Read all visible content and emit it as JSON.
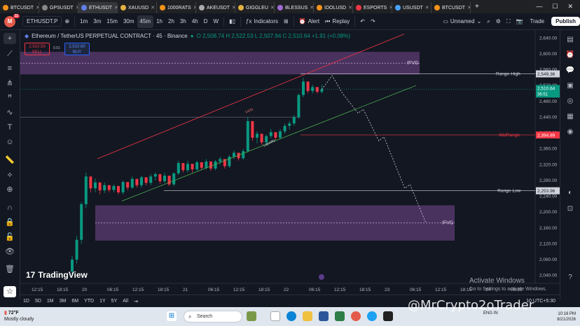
{
  "browser": {
    "tabs": [
      {
        "label": "BTCUSDT",
        "color": "#f7931a",
        "active": false
      },
      {
        "label": "GPSUSDT",
        "color": "#888888",
        "active": false
      },
      {
        "label": "ETHUSDT",
        "color": "#627eea",
        "active": true
      },
      {
        "label": "XAUUSD",
        "color": "#e3b341",
        "active": false
      },
      {
        "label": "1000RATS",
        "color": "#f7931a",
        "active": false
      },
      {
        "label": "AKEUSDT",
        "color": "#aaaaaa",
        "active": false
      },
      {
        "label": "GIGGLEU",
        "color": "#e3b341",
        "active": false
      },
      {
        "label": "BLESSUS",
        "color": "#a06cd5",
        "active": false
      },
      {
        "label": "IDOLUSD",
        "color": "#f7931a",
        "active": false
      },
      {
        "label": "ESPORTS",
        "color": "#f23645",
        "active": false
      },
      {
        "label": "USUSDT",
        "color": "#4aa3ff",
        "active": false
      },
      {
        "label": "BTCUSDT",
        "color": "#f7931a",
        "active": false
      }
    ]
  },
  "toolbar": {
    "avatar_letter": "M",
    "avatar_badge": "11",
    "symbol": "ETHUSDT.P",
    "intervals": [
      "1m",
      "3m",
      "15m",
      "30m",
      "45m",
      "1h",
      "2h",
      "3h",
      "4h",
      "D",
      "W"
    ],
    "active_interval": "45m",
    "indicators_label": "Indicators",
    "alert_label": "Alert",
    "replay_label": "Replay",
    "layout_name": "Unnamed",
    "trade_label": "Trade",
    "publish_label": "Publish"
  },
  "header": {
    "title": "Ethereum / TetherUS PERPETUAL CONTRACT · 45 · Binance",
    "ohlc": "O 2,508.74  H 2,522.53  L 2,507.94  C 2,510.64  +1.91 (+0.08%)",
    "sell_price": "2,510.59",
    "sell_label": "SELL",
    "buy_price": "2,510.60",
    "buy_label": "BUY",
    "spread": "0.01"
  },
  "chart_data": {
    "type": "candlestick",
    "price_axis": [
      "2,640.00",
      "2,600.00",
      "2,560.00",
      "2,520.00",
      "2,480.00",
      "2,440.00",
      "2,400.00",
      "2,360.00",
      "2,320.00",
      "2,280.00",
      "2,240.00",
      "2,200.00",
      "2,160.00",
      "2,120.00",
      "2,080.00",
      "2,040.00"
    ],
    "price_axis_values": [
      2640,
      2600,
      2560,
      2520,
      2480,
      2440,
      2400,
      2360,
      2320,
      2280,
      2240,
      2200,
      2160,
      2120,
      2080,
      2040
    ],
    "time_axis": [
      "12:15",
      "18:15",
      "20",
      "06:15",
      "12:15",
      "18:15",
      "21",
      "06:15",
      "12:15",
      "18:15",
      "22",
      "06:15",
      "12:15",
      "18:15",
      "23",
      "06:15",
      "12:15",
      "18:15",
      "24",
      "06:15"
    ],
    "ylim": [
      2020,
      2660
    ],
    "levels": [
      {
        "label": "Range-High",
        "value": 2549.36,
        "tag": "2,549.36",
        "color": "#d1d4dc"
      },
      {
        "label": "MidRange",
        "value": 2394.89,
        "tag": "2,394.89",
        "color": "#f23645"
      },
      {
        "label": "Range-Low",
        "value": 2253.96,
        "tag": "2,253.96",
        "color": "#d1d4dc"
      }
    ],
    "current_price": {
      "value": 2510.64,
      "tag": "2,510.64",
      "countdown": "36:51",
      "color": "#089981"
    },
    "zones": [
      {
        "label": "IFVG",
        "top": 2605,
        "bottom": 2548
      },
      {
        "label": "IFVG",
        "top": 2217,
        "bottom": 2128
      }
    ],
    "channel_labels": {
      "upper": "Liq'ty",
      "lower": "Liquidity"
    },
    "candles": [
      [
        2050,
        2090,
        2040,
        2080
      ],
      [
        2080,
        2140,
        2070,
        2130
      ],
      [
        2130,
        2225,
        2120,
        2220
      ],
      [
        2220,
        2300,
        2210,
        2290
      ],
      [
        2290,
        2270,
        2250,
        2260
      ],
      [
        2260,
        2285,
        2250,
        2275
      ],
      [
        2275,
        2265,
        2245,
        2255
      ],
      [
        2255,
        2275,
        2248,
        2268
      ],
      [
        2268,
        2262,
        2250,
        2256
      ],
      [
        2256,
        2270,
        2250,
        2266
      ],
      [
        2266,
        2258,
        2245,
        2250
      ],
      [
        2250,
        2280,
        2245,
        2276
      ],
      [
        2276,
        2268,
        2255,
        2262
      ],
      [
        2262,
        2290,
        2258,
        2284
      ],
      [
        2284,
        2278,
        2262,
        2268
      ],
      [
        2268,
        2292,
        2262,
        2288
      ],
      [
        2288,
        2280,
        2268,
        2274
      ],
      [
        2274,
        2296,
        2268,
        2290
      ],
      [
        2290,
        2300,
        2280,
        2296
      ],
      [
        2296,
        2284,
        2272,
        2278
      ],
      [
        2278,
        2300,
        2274,
        2292
      ],
      [
        2292,
        2286,
        2266,
        2270
      ],
      [
        2270,
        2300,
        2266,
        2298
      ],
      [
        2298,
        2330,
        2294,
        2324
      ],
      [
        2324,
        2312,
        2300,
        2306
      ],
      [
        2306,
        2330,
        2300,
        2322
      ],
      [
        2322,
        2316,
        2300,
        2308
      ],
      [
        2308,
        2330,
        2304,
        2326
      ],
      [
        2326,
        2318,
        2306,
        2312
      ],
      [
        2312,
        2334,
        2308,
        2328
      ],
      [
        2328,
        2316,
        2304,
        2310
      ],
      [
        2310,
        2332,
        2306,
        2328
      ],
      [
        2328,
        2340,
        2320,
        2334
      ],
      [
        2334,
        2322,
        2310,
        2316
      ],
      [
        2316,
        2344,
        2312,
        2340
      ],
      [
        2340,
        2356,
        2334,
        2350
      ],
      [
        2350,
        2340,
        2330,
        2336
      ],
      [
        2336,
        2360,
        2332,
        2354
      ],
      [
        2354,
        2440,
        2350,
        2430
      ],
      [
        2430,
        2404,
        2380,
        2388
      ],
      [
        2388,
        2404,
        2374,
        2398
      ],
      [
        2398,
        2384,
        2370,
        2376
      ],
      [
        2376,
        2396,
        2370,
        2392
      ],
      [
        2392,
        2410,
        2386,
        2402
      ],
      [
        2402,
        2394,
        2382,
        2388
      ],
      [
        2388,
        2410,
        2384,
        2404
      ],
      [
        2404,
        2424,
        2398,
        2418
      ],
      [
        2418,
        2430,
        2408,
        2424
      ],
      [
        2424,
        2446,
        2418,
        2440
      ],
      [
        2440,
        2500,
        2436,
        2496
      ],
      [
        2496,
        2540,
        2490,
        2530
      ],
      [
        2530,
        2518,
        2500,
        2506
      ],
      [
        2506,
        2522,
        2500,
        2516
      ],
      [
        2516,
        2510,
        2500,
        2504
      ],
      [
        2504,
        2522,
        2500,
        2510
      ]
    ],
    "projection": [
      [
        2510,
        0
      ],
      [
        2545,
        2
      ],
      [
        2500,
        4
      ],
      [
        2450,
        7
      ],
      [
        2460,
        8
      ],
      [
        2380,
        11
      ],
      [
        2390,
        12
      ],
      [
        2260,
        16
      ],
      [
        2270,
        17
      ],
      [
        2175,
        20
      ]
    ]
  },
  "range_bar": {
    "ranges": [
      "1D",
      "5D",
      "1M",
      "3M",
      "6M",
      "YTD",
      "1Y",
      "5Y",
      "All"
    ],
    "timezone": "10 UTC+5:30"
  },
  "logo_text": "TradingView",
  "watermark": "@MrCrypto2oTrader",
  "activate": {
    "title": "Activate Windows",
    "sub": "Go to Settings to activate Windows."
  },
  "taskbar": {
    "weather_temp": "72°F",
    "weather_desc": "Mostly cloudy",
    "search_placeholder": "Search",
    "lang": "ENG IN",
    "time": "10:18 PM",
    "date": "8/21/2026"
  }
}
